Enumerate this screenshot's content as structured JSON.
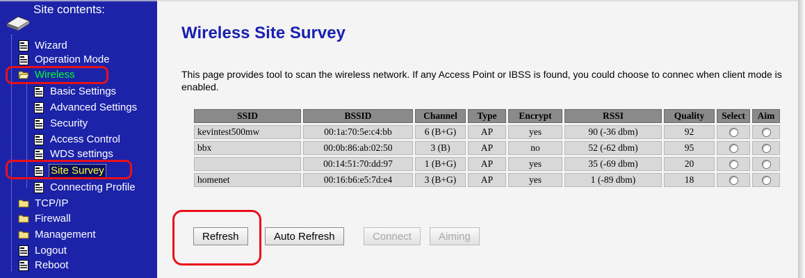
{
  "sidebar": {
    "title": "Site contents:",
    "items": [
      {
        "label": "Wizard",
        "icon": "page-icon"
      },
      {
        "label": "Operation Mode",
        "icon": "page-icon"
      },
      {
        "label": "Wireless",
        "icon": "folder-open-icon",
        "state": "expanded"
      },
      {
        "label": "Basic Settings",
        "icon": "page-icon"
      },
      {
        "label": "Advanced Settings",
        "icon": "page-icon"
      },
      {
        "label": "Security",
        "icon": "page-icon"
      },
      {
        "label": "Access Control",
        "icon": "page-icon"
      },
      {
        "label": "WDS settings",
        "icon": "page-icon"
      },
      {
        "label": "Site Survey",
        "icon": "page-icon",
        "state": "selected"
      },
      {
        "label": "Connecting Profile",
        "icon": "page-icon"
      },
      {
        "label": "TCP/IP",
        "icon": "folder-icon"
      },
      {
        "label": "Firewall",
        "icon": "folder-icon"
      },
      {
        "label": "Management",
        "icon": "folder-icon"
      },
      {
        "label": "Logout",
        "icon": "page-icon"
      },
      {
        "label": "Reboot",
        "icon": "page-icon"
      }
    ]
  },
  "main": {
    "title": "Wireless Site Survey",
    "description": "This page provides tool to scan the wireless network. If any Access Point or IBSS is found, you could choose to connec when client mode is enabled.",
    "table": {
      "columns": [
        "SSID",
        "BSSID",
        "Channel",
        "Type",
        "Encrypt",
        "RSSI",
        "Quality",
        "Select",
        "Aim"
      ],
      "rows": [
        {
          "ssid": "kevintest500mw",
          "bssid": "00:1a:70:5e:c4:bb",
          "channel": "6 (B+G)",
          "type": "AP",
          "encrypt": "yes",
          "rssi": "90 (-36 dbm)",
          "quality": "92"
        },
        {
          "ssid": "bbx",
          "bssid": "00:0b:86:ab:02:50",
          "channel": "3 (B)",
          "type": "AP",
          "encrypt": "no",
          "rssi": "52 (-62 dbm)",
          "quality": "95"
        },
        {
          "ssid": "",
          "bssid": "00:14:51:70:dd:97",
          "channel": "1 (B+G)",
          "type": "AP",
          "encrypt": "yes",
          "rssi": "35 (-69 dbm)",
          "quality": "20"
        },
        {
          "ssid": "homenet",
          "bssid": "00:16:b6:e5:7d:e4",
          "channel": "3 (B+G)",
          "type": "AP",
          "encrypt": "yes",
          "rssi": "1 (-89 dbm)",
          "quality": "18"
        }
      ]
    },
    "buttons": {
      "refresh": "Refresh",
      "auto_refresh": "Auto Refresh",
      "connect": "Connect",
      "aiming": "Aiming"
    }
  },
  "colors": {
    "sidebar_bg": "#1c23a8",
    "title": "#1a20b0",
    "highlight_box": "#e8101a",
    "active_text": "#00ff33",
    "current_text": "#ffff33"
  }
}
